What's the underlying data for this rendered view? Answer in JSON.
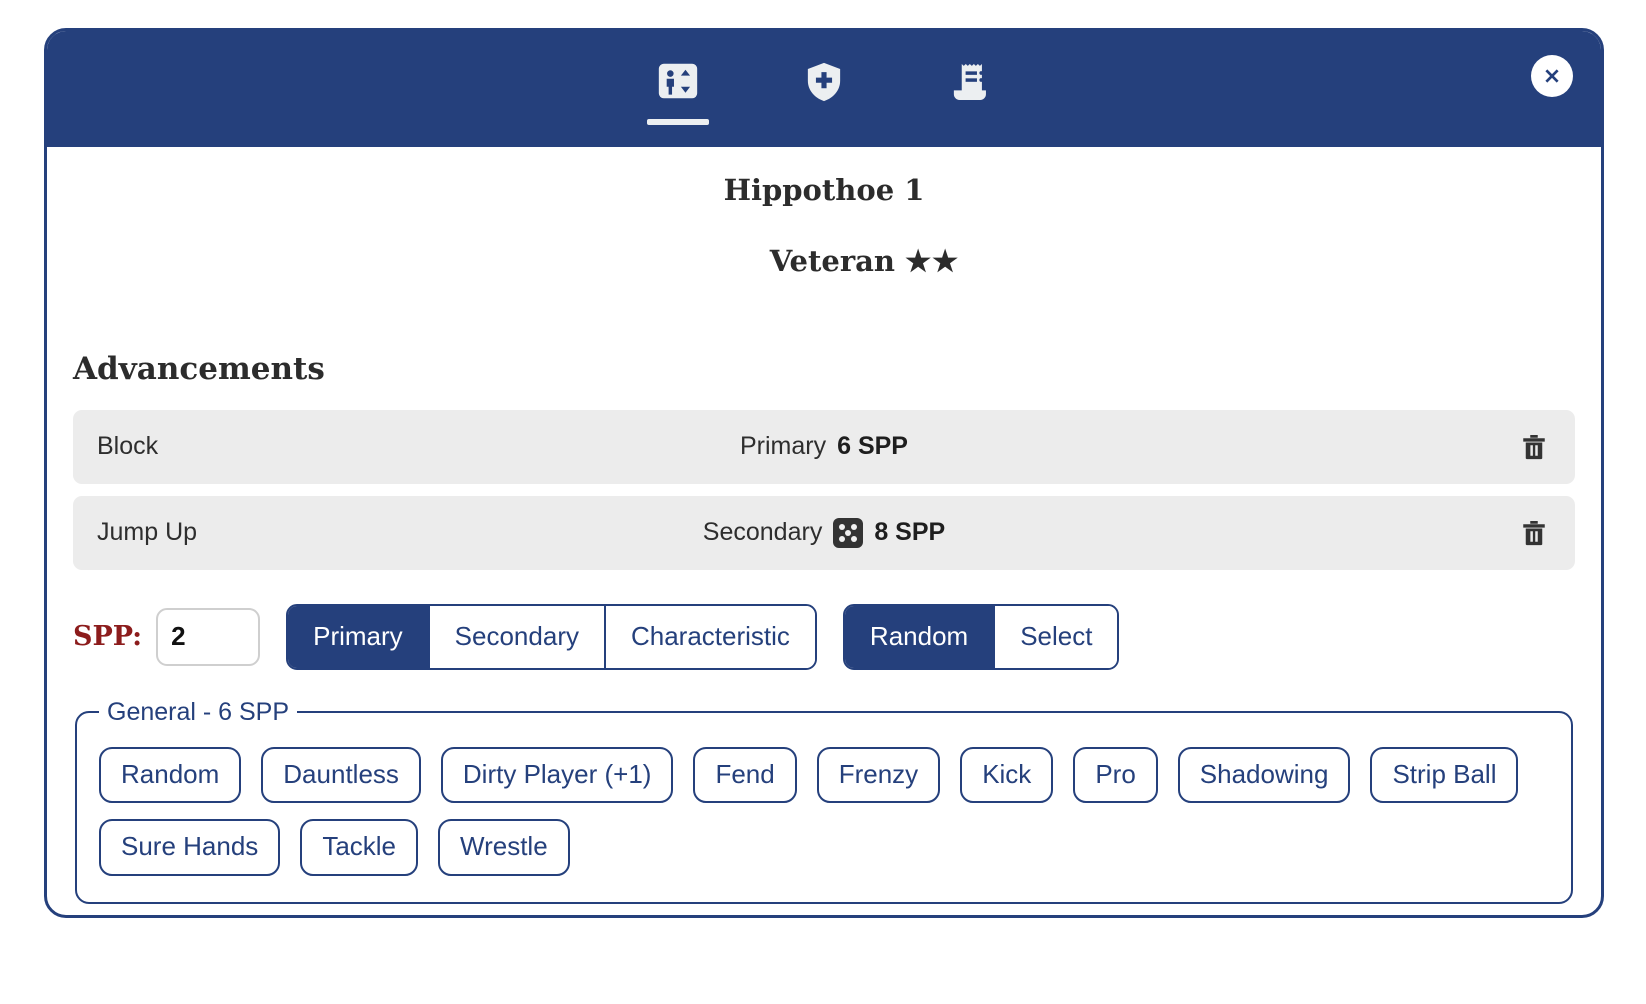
{
  "header": {
    "tabs": [
      {
        "name": "player-development",
        "icon": "player-advancement-icon",
        "active": true
      },
      {
        "name": "injuries",
        "icon": "shield-plus-icon",
        "active": false
      },
      {
        "name": "ledger",
        "icon": "receipt-icon",
        "active": false
      }
    ],
    "close_label": "Close"
  },
  "player": {
    "name": "Hippothoe 1",
    "rank": "Veteran",
    "stars": "★★"
  },
  "advancements": {
    "section_title": "Advancements",
    "rows": [
      {
        "skill": "Block",
        "type": "Primary",
        "spp": "6 SPP",
        "has_die": false,
        "delete_label": "Delete"
      },
      {
        "skill": "Jump Up",
        "type": "Secondary",
        "spp": "8 SPP",
        "has_die": true,
        "delete_label": "Delete"
      }
    ]
  },
  "controls": {
    "spp_label": "SPP:",
    "spp_value": "2",
    "spp_placeholder": "",
    "category_options": [
      {
        "label": "Primary",
        "active": true
      },
      {
        "label": "Secondary",
        "active": false
      },
      {
        "label": "Characteristic",
        "active": false
      }
    ],
    "mode_options": [
      {
        "label": "Random",
        "active": true
      },
      {
        "label": "Select",
        "active": false
      }
    ]
  },
  "skills": {
    "legend": "General - 6 SPP",
    "items": [
      "Random",
      "Dauntless",
      "Dirty Player (+1)",
      "Fend",
      "Frenzy",
      "Kick",
      "Pro",
      "Shadowing",
      "Strip Ball",
      "Sure Hands",
      "Tackle",
      "Wrestle"
    ]
  },
  "colors": {
    "navy": "#25407c",
    "row_gray": "#ececec",
    "spp_red": "#8c1c1c",
    "die_dark": "#333333"
  }
}
